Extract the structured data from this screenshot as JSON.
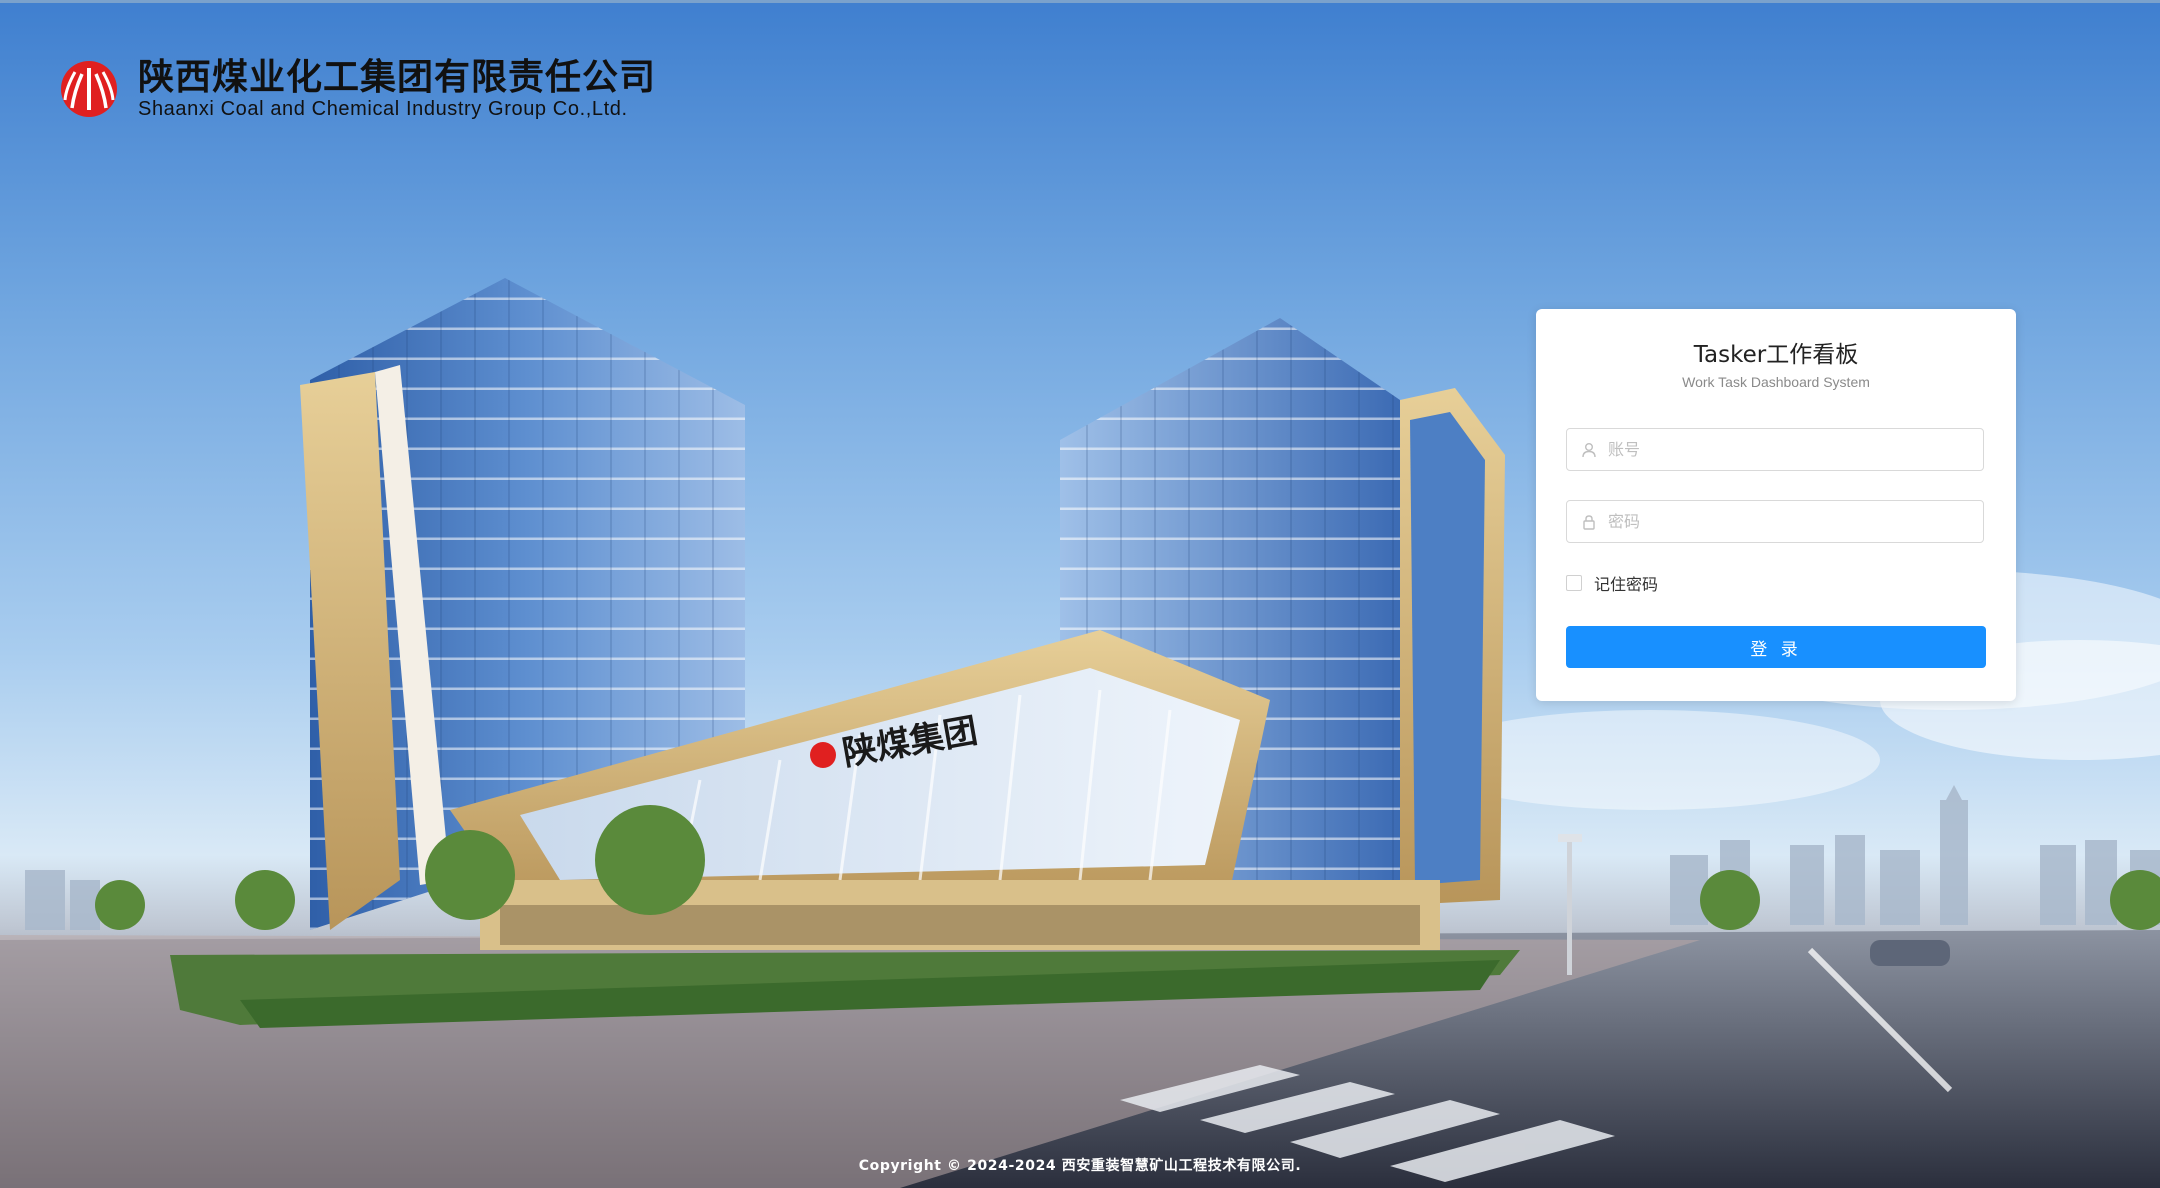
{
  "company": {
    "name_cn": "陕西煤业化工集团有限责任公司",
    "name_en": "Shaanxi Coal and Chemical  Industry Group Co.,Ltd."
  },
  "building_sign": "陕煤集团",
  "login": {
    "title": "Tasker工作看板",
    "subtitle": "Work Task Dashboard System",
    "username_placeholder": "账号",
    "password_placeholder": "密码",
    "remember_label": "记住密码",
    "remember_checked": false,
    "submit_label": "登 录"
  },
  "footer": {
    "copyright": "Copyright © 2024-2024 西安重装智慧矿山工程技术有限公司."
  },
  "icons": {
    "user": "user-icon",
    "lock": "lock-icon",
    "logo": "logo-icon"
  },
  "colors": {
    "primary": "#1890ff",
    "logo_red": "#e02020"
  }
}
